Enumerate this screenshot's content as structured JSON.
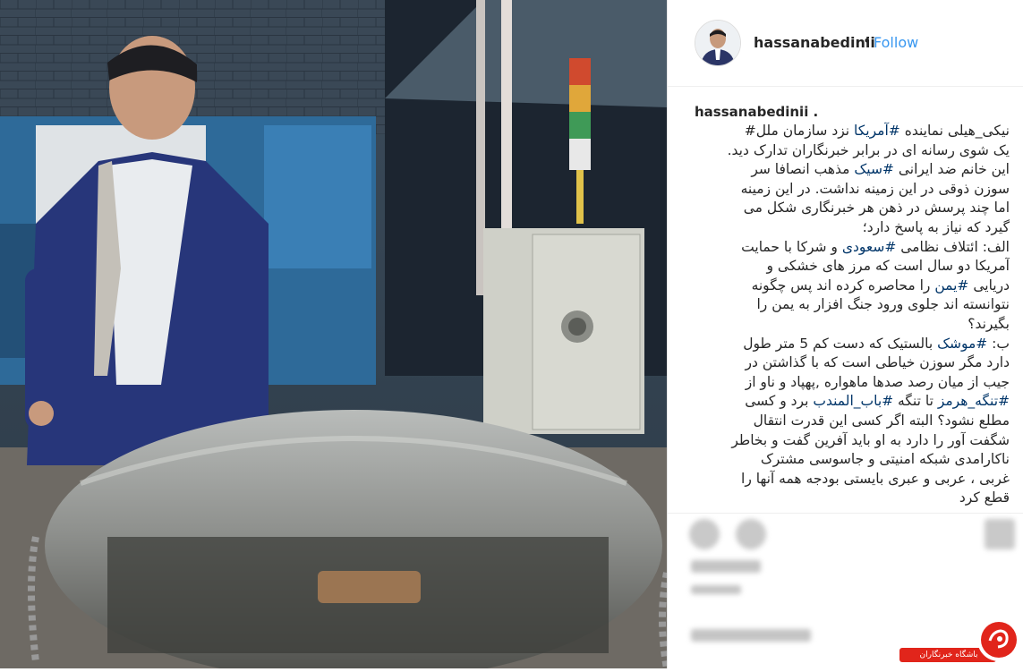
{
  "post": {
    "username": "hassanabedinii",
    "dot": "•",
    "follow_label": "Follow",
    "caption_username": "hassanabedinii .",
    "caption_lines": [
      "نیکی_هیلی نماینده #آمریکا نزد سازمان ملل#",
      "یک شوی رسانه ای در برابر خبرنگاران تدارک دید.",
      "این خانم ضد ایرانی  #سیک مذهب انصافا سر",
      "سوزن ذوقی در این زمینه نداشت. در این زمینه",
      "اما چند پرسش در ذهن هر خبرنگاری شکل می",
      "گیرد که نیاز به پاسخ دارد؛",
      "الف: ائتلاف نظامی  #سعودی و شرکا با حمایت",
      "آمریکا دو سال است که مرز های خشکی و",
      "دریایی  #یمن را محاصره کرده اند پس چگونه",
      "نتوانسته اند جلوی ورود جنگ افزار به یمن را",
      "بگیرند؟",
      "ب: #موشک بالستیک که دست کم 5 متر طول",
      "دارد مگر سوزن خیاطی است که با گذاشتن در",
      "جیب از میان رصد صدها ماهواره ,پهپاد و ناو از",
      "#تنگه_هرمز تا تنگه  #باب_المندب برد و کسی",
      "مطلع نشود؟ البته اگر کسی این قدرت انتقال",
      "شگفت آور را دارد به او باید آفرین گفت و بخاطر",
      "ناکارامدی شبکه امنیتی و جاسوسی مشترک",
      "غربی ، عربی و عبری بایستی بودجه همه آنها را",
      "قطع کرد"
    ]
  },
  "watermark": {
    "brand_label": "باشگاه خبرنگاران",
    "brand_color": "#e1251b"
  },
  "icons": [
    "heart-icon",
    "comment-icon",
    "bookmark-icon",
    "avatar",
    "close-icon"
  ]
}
